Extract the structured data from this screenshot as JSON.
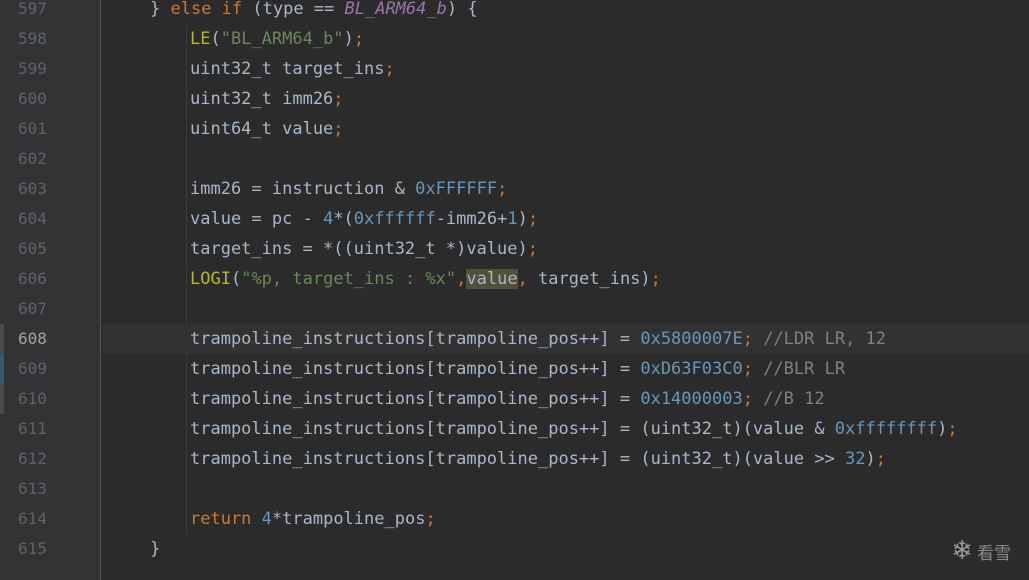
{
  "editor": {
    "line_numbers": [
      "597",
      "598",
      "599",
      "600",
      "601",
      "602",
      "603",
      "604",
      "605",
      "606",
      "607",
      "608",
      "609",
      "610",
      "611",
      "612",
      "613",
      "614",
      "615"
    ],
    "current_line": "608",
    "lines": [
      [
        {
          "t": "} ",
          "c": "plain"
        },
        {
          "t": "else if",
          "c": "kw"
        },
        {
          "t": " (type == ",
          "c": "plain"
        },
        {
          "t": "BL_ARM64_b",
          "c": "constv"
        },
        {
          "t": ") {",
          "c": "plain"
        }
      ],
      [
        {
          "t": "LE",
          "c": "mac"
        },
        {
          "t": "(",
          "c": "plain"
        },
        {
          "t": "\"BL_ARM64_b\"",
          "c": "str"
        },
        {
          "t": ")",
          "c": "plain"
        },
        {
          "t": ";",
          "c": "punc"
        }
      ],
      [
        {
          "t": "uint32_t target_ins",
          "c": "plain"
        },
        {
          "t": ";",
          "c": "punc"
        }
      ],
      [
        {
          "t": "uint32_t imm26",
          "c": "plain"
        },
        {
          "t": ";",
          "c": "punc"
        }
      ],
      [
        {
          "t": "uint64_t value",
          "c": "plain"
        },
        {
          "t": ";",
          "c": "punc"
        }
      ],
      [],
      [
        {
          "t": "imm26 = instruction & ",
          "c": "plain"
        },
        {
          "t": "0xFFFFFF",
          "c": "num"
        },
        {
          "t": ";",
          "c": "punc"
        }
      ],
      [
        {
          "t": "value = pc - ",
          "c": "plain"
        },
        {
          "t": "4",
          "c": "num"
        },
        {
          "t": "*(",
          "c": "plain"
        },
        {
          "t": "0xffffff",
          "c": "num"
        },
        {
          "t": "-imm26+",
          "c": "plain"
        },
        {
          "t": "1",
          "c": "num"
        },
        {
          "t": ")",
          "c": "plain"
        },
        {
          "t": ";",
          "c": "punc"
        }
      ],
      [
        {
          "t": "target_ins = *((uint32_t *)value)",
          "c": "plain"
        },
        {
          "t": ";",
          "c": "punc"
        }
      ],
      [
        {
          "t": "LOGI",
          "c": "mac"
        },
        {
          "t": "(",
          "c": "plain"
        },
        {
          "t": "\"%p, target_ins : %x\"",
          "c": "str"
        },
        {
          "t": ",",
          "c": "punc"
        },
        {
          "t": "value",
          "c": "plain hl"
        },
        {
          "t": ",",
          "c": "punc"
        },
        {
          "t": " target_ins)",
          "c": "plain"
        },
        {
          "t": ";",
          "c": "punc"
        }
      ],
      [],
      [
        {
          "t": "trampoline_instructions[trampoline_pos++] = ",
          "c": "plain"
        },
        {
          "t": "0x5800007E",
          "c": "num"
        },
        {
          "t": ";",
          "c": "punc"
        },
        {
          "t": " //LDR LR, 12",
          "c": "cmt"
        }
      ],
      [
        {
          "t": "trampoline_instructions[trampoline_pos++] = ",
          "c": "plain"
        },
        {
          "t": "0xD63F03C0",
          "c": "num"
        },
        {
          "t": ";",
          "c": "punc"
        },
        {
          "t": " //BLR LR",
          "c": "cmt"
        }
      ],
      [
        {
          "t": "trampoline_instructions[trampoline_pos++] = ",
          "c": "plain"
        },
        {
          "t": "0x14000003",
          "c": "num"
        },
        {
          "t": ";",
          "c": "punc"
        },
        {
          "t": " //B 12",
          "c": "cmt"
        }
      ],
      [
        {
          "t": "trampoline_instructions[trampoline_pos++] = (uint32_t)(value & ",
          "c": "plain"
        },
        {
          "t": "0xffffffff",
          "c": "num"
        },
        {
          "t": ")",
          "c": "plain"
        },
        {
          "t": ";",
          "c": "punc"
        }
      ],
      [
        {
          "t": "trampoline_instructions[trampoline_pos++] = (uint32_t)(value >> ",
          "c": "plain"
        },
        {
          "t": "32",
          "c": "num"
        },
        {
          "t": ")",
          "c": "plain"
        },
        {
          "t": ";",
          "c": "punc"
        }
      ],
      [],
      [
        {
          "t": "return ",
          "c": "kw"
        },
        {
          "t": "4",
          "c": "num"
        },
        {
          "t": "*trampoline_pos",
          "c": "plain"
        },
        {
          "t": ";",
          "c": "punc"
        }
      ],
      [
        {
          "t": "}",
          "c": "plain"
        }
      ]
    ]
  },
  "watermark": {
    "text": "看雪",
    "icon": "snowflake-icon"
  }
}
